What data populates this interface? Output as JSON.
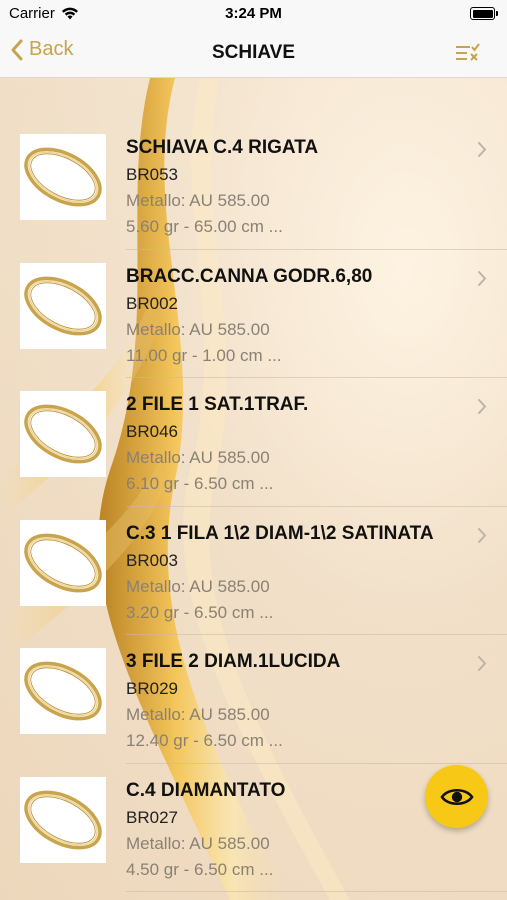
{
  "status_bar": {
    "carrier": "Carrier",
    "time": "3:24 PM",
    "icons": [
      "wifi-icon",
      "battery-icon"
    ]
  },
  "nav": {
    "back_label": "Back",
    "title": "SCHIAVE",
    "filter_icon": "filter-list-icon"
  },
  "accent_color": "#c8a34f",
  "fab": {
    "icon": "eye-icon",
    "color": "#f8c816"
  },
  "items": [
    {
      "title": "SCHIAVA C.4 RIGATA",
      "code": "BR053",
      "metal": "Metallo: AU 585.00",
      "specs": "5.60 gr - 65.00 cm ..."
    },
    {
      "title": "BRACC.CANNA GODR.6,80",
      "code": "BR002",
      "metal": "Metallo: AU 585.00",
      "specs": "11.00 gr - 1.00 cm ..."
    },
    {
      "title": "2 FILE 1 SAT.1TRAF.",
      "code": "BR046",
      "metal": "Metallo: AU 585.00",
      "specs": "6.10 gr - 6.50 cm ..."
    },
    {
      "title": "C.3 1 FILA 1\\2 DIAM-1\\2 SATINATA",
      "code": "BR003",
      "metal": "Metallo: AU 585.00",
      "specs": "3.20 gr - 6.50 cm ..."
    },
    {
      "title": "3 FILE 2 DIAM.1LUCIDA",
      "code": "BR029",
      "metal": "Metallo: AU 585.00",
      "specs": "12.40 gr - 6.50 cm ..."
    },
    {
      "title": "C.4 DIAMANTATO",
      "code": "BR027",
      "metal": "Metallo: AU 585.00",
      "specs": "4.50 gr - 6.50 cm ..."
    }
  ]
}
